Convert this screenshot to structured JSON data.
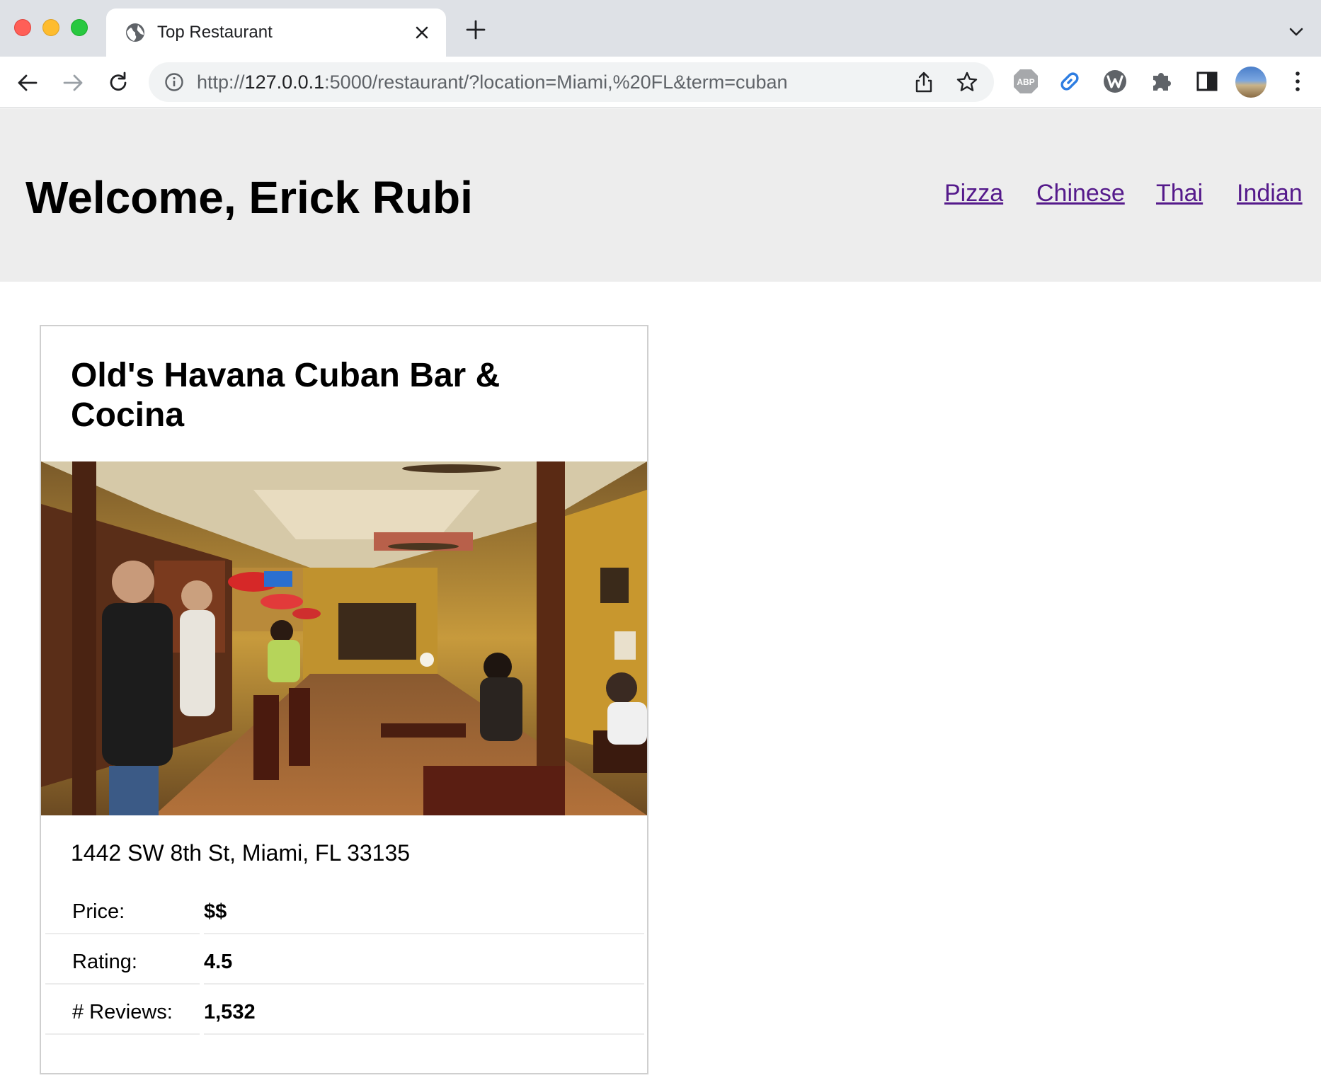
{
  "browser": {
    "tab_title": "Top Restaurant",
    "url_prefix": "http://",
    "url_host": "127.0.0.1",
    "url_rest": ":5000/restaurant/?location=Miami,%20FL&term=cuban"
  },
  "header": {
    "welcome": "Welcome, Erick Rubi",
    "nav": [
      "Pizza",
      "Chinese",
      "Thai",
      "Indian"
    ]
  },
  "restaurant": {
    "name": "Old's Havana Cuban Bar & Cocina",
    "address": "1442 SW 8th St, Miami, FL 33135",
    "details": [
      {
        "label": "Price:",
        "value": "$$"
      },
      {
        "label": "Rating:",
        "value": "4.5"
      },
      {
        "label": "# Reviews:",
        "value": "1,532"
      }
    ]
  },
  "icons": {
    "tab_favicon": "globe-icon",
    "extensions": [
      "adblock-plus-icon",
      "link-icon",
      "w-extension-icon",
      "puzzle-icon",
      "side-panel-icon"
    ]
  }
}
